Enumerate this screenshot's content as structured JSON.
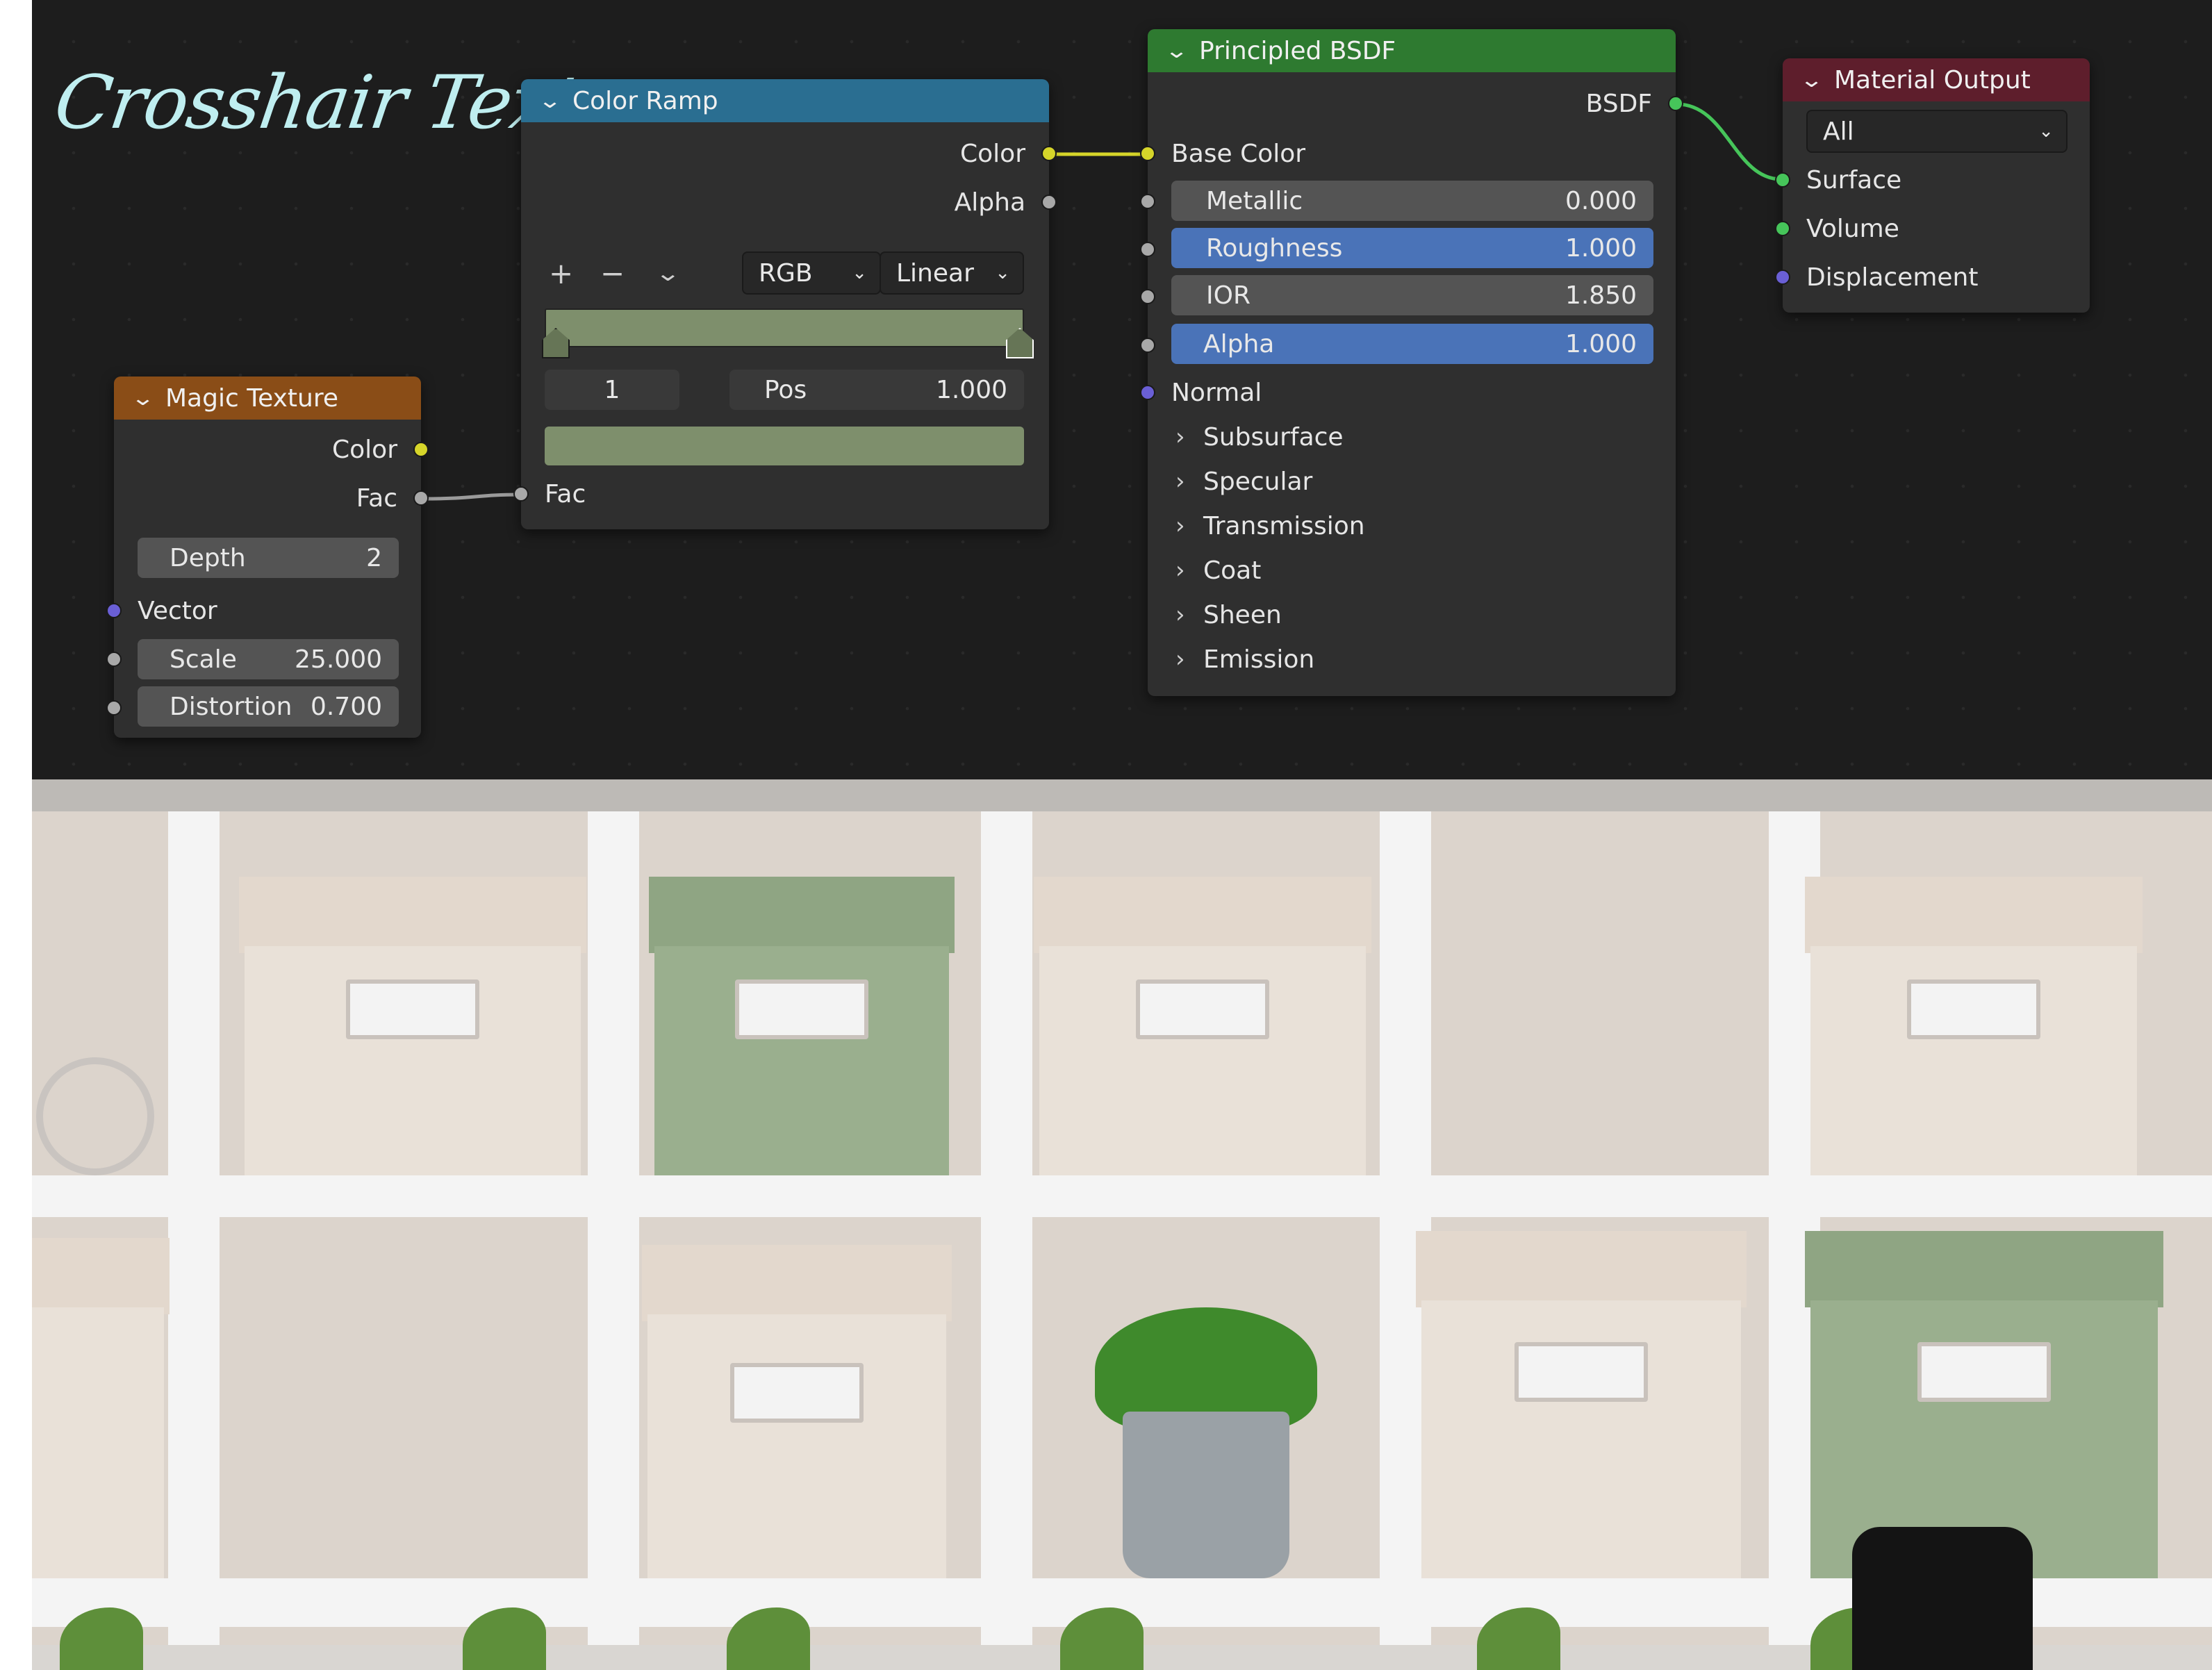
{
  "title": "Crosshair Texture",
  "colors": {
    "color_ramp_header": "#2a6e91",
    "magic_texture_header": "#8a4d17",
    "principled_header": "#2e7a30",
    "material_output_header": "#5e1e2c",
    "ramp_color": "#7e8f6c",
    "link_yellow": "#d6d52a",
    "link_green": "#46c55a"
  },
  "magic_texture": {
    "header": "Magic Texture",
    "output_color": "Color",
    "output_fac": "Fac",
    "depth_label": "Depth",
    "depth_value": "2",
    "vector_label": "Vector",
    "scale_label": "Scale",
    "scale_value": "25.000",
    "distortion_label": "Distortion",
    "distortion_value": "0.700"
  },
  "color_ramp": {
    "header": "Color Ramp",
    "output_color": "Color",
    "output_alpha": "Alpha",
    "add_icon": "+",
    "remove_icon": "−",
    "color_mode": "RGB",
    "interpolation": "Linear",
    "stop_index": "1",
    "pos_label": "Pos",
    "pos_value": "1.000",
    "input_fac": "Fac"
  },
  "principled": {
    "header": "Principled BSDF",
    "output_bsdf": "BSDF",
    "base_color": "Base Color",
    "metallic_label": "Metallic",
    "metallic_value": "0.000",
    "roughness_label": "Roughness",
    "roughness_value": "1.000",
    "ior_label": "IOR",
    "ior_value": "1.850",
    "alpha_label": "Alpha",
    "alpha_value": "1.000",
    "normal_label": "Normal",
    "panels": [
      "Subsurface",
      "Specular",
      "Transmission",
      "Coat",
      "Sheen",
      "Emission"
    ]
  },
  "material_output": {
    "header": "Material Output",
    "target": "All",
    "surface": "Surface",
    "volume": "Volume",
    "displacement": "Displacement"
  }
}
